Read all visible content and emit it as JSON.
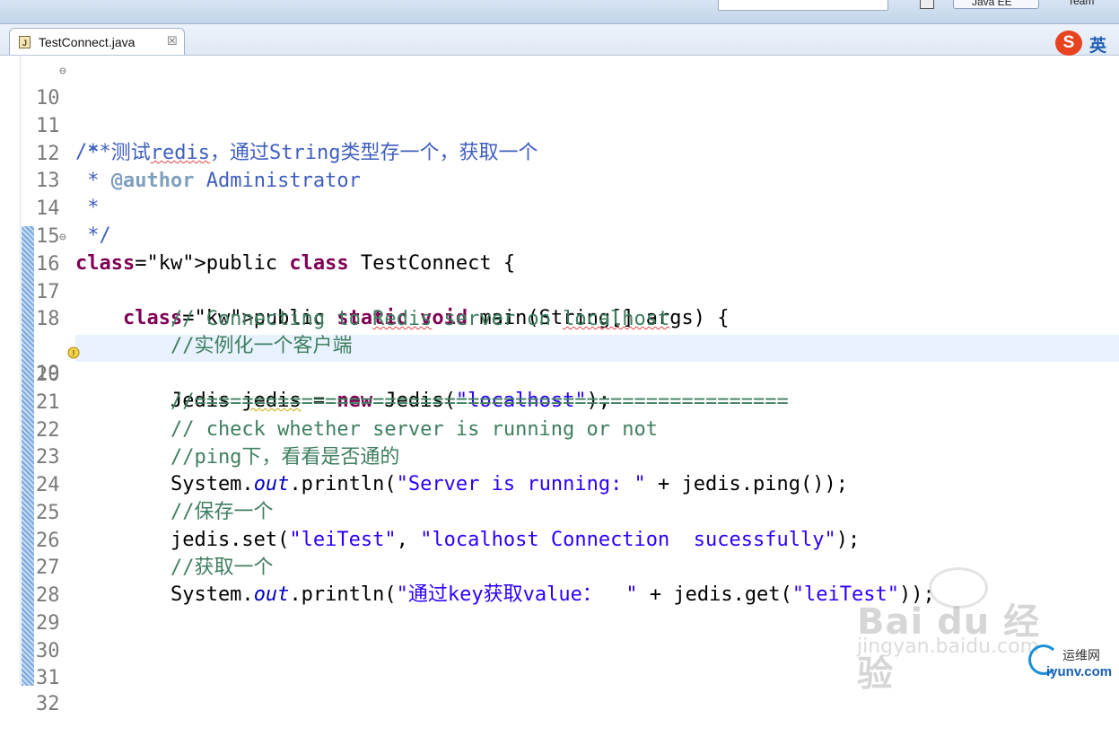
{
  "toolbar": {
    "search_placeholder": "",
    "perspective_label": "Java EE",
    "perspective2_label": "Team"
  },
  "tab": {
    "filename": "TestConnect.java",
    "close_glyph": "☒"
  },
  "ime": {
    "logo": "S",
    "mode": "英"
  },
  "lines": [
    {
      "n": "10",
      "t": "/**"
    },
    {
      "n": "11",
      "t": " * 测试redis，通过String类型存一个，获取一个"
    },
    {
      "n": "12",
      "t": " * @author Administrator"
    },
    {
      "n": "13",
      "t": " *"
    },
    {
      "n": "14",
      "t": " */"
    },
    {
      "n": "15",
      "t": "public class TestConnect {"
    },
    {
      "n": "16",
      "t": "    public static void main(String[] args) {"
    },
    {
      "n": "17",
      "t": "        // Connecting to Redis server on localhost"
    },
    {
      "n": "18",
      "t": "        //实例化一个客户端"
    },
    {
      "n": "19",
      "t": "        Jedis jedis = new Jedis(\"localhost\");"
    },
    {
      "n": "20",
      "t": "        //=================================================="
    },
    {
      "n": "21",
      "t": "        // check whether server is running or not"
    },
    {
      "n": "22",
      "t": "        //ping下，看看是否通的"
    },
    {
      "n": "23",
      "t": "        System.out.println(\"Server is running: \" + jedis.ping());"
    },
    {
      "n": "24",
      "t": "        //保存一个"
    },
    {
      "n": "25",
      "t": "        jedis.set(\"leiTest\", \"localhost Connection  sucessfully\");"
    },
    {
      "n": "26",
      "t": "        //获取一个"
    },
    {
      "n": "27",
      "t": "        System.out.println(\"通过key获取value：  \" + jedis.get(\"leiTest\"));"
    },
    {
      "n": "28",
      "t": ""
    },
    {
      "n": "29",
      "t": ""
    },
    {
      "n": "30",
      "t": ""
    },
    {
      "n": "31",
      "t": ""
    },
    {
      "n": "32",
      "t": ""
    }
  ],
  "watermark": {
    "brand": "Bai du 经验",
    "url": "jingyan.baidu.com"
  },
  "iyunv": {
    "name": "运维网",
    "url": "iyunv.com"
  },
  "colors": {
    "keyword": "#7f0055",
    "comment": "#3f7f5f",
    "javadoc": "#3f5fbf",
    "string": "#2a00ff",
    "field": "#0000c0",
    "current_line": "#e8f2fe"
  }
}
